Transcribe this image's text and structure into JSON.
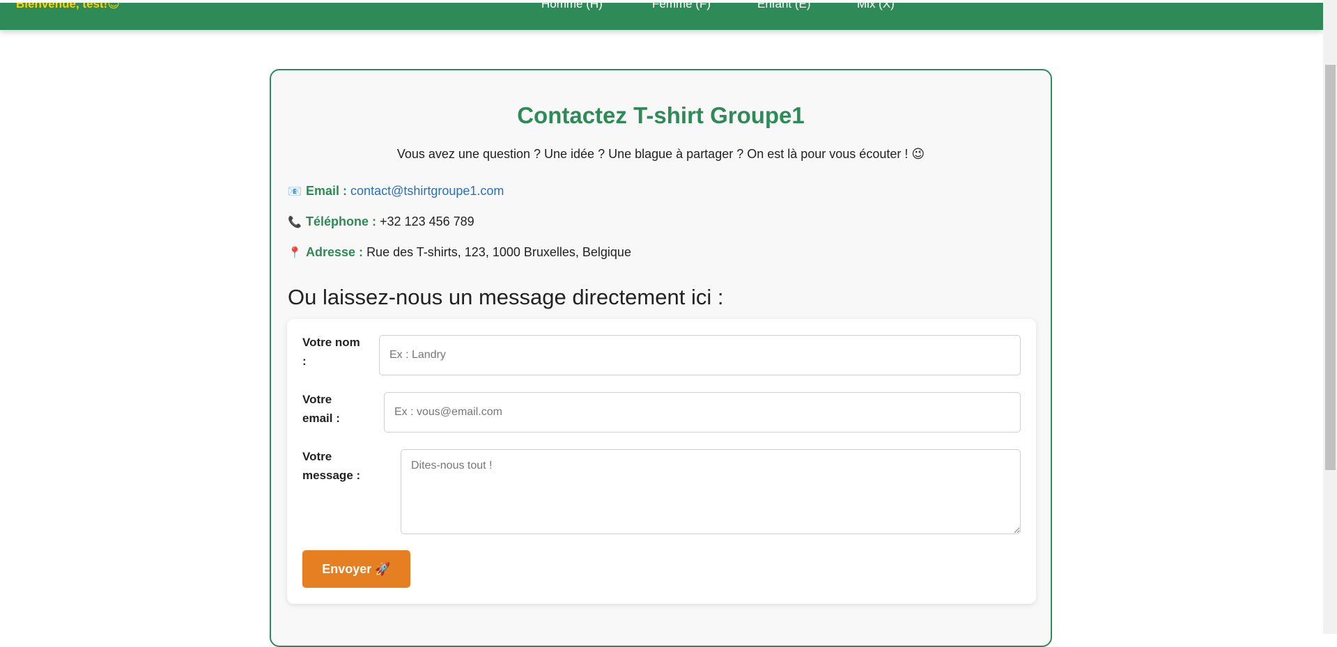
{
  "navbar": {
    "welcome": "Bienvenue, test!😊",
    "links": [
      "Homme (H)",
      "Femme (F)",
      "Enfant (E)",
      "Mix (X)"
    ],
    "bg_color": "#2e8b57",
    "welcome_color": "#ffd200"
  },
  "contact": {
    "title": "Contactez T-shirt Groupe1",
    "subtitle": "Vous avez une question ? Une idée ? Une blague à partager ? On est là pour vous écouter ! 😉",
    "email": {
      "icon": "envelope-icon",
      "glyph": "📧",
      "label": "Email :",
      "value": "contact@tshirtgroupe1.com"
    },
    "phone": {
      "icon": "phone-icon",
      "glyph": "📞",
      "label": "Téléphone :",
      "value": "+32 123 456 789"
    },
    "address": {
      "icon": "pin-icon",
      "glyph": "📍",
      "label": "Adresse :",
      "value": "Rue des T-shirts, 123, 1000 Bruxelles, Belgique"
    }
  },
  "form": {
    "heading": "Ou laissez-nous un message directement ici :",
    "name_label_1": "Votre nom",
    "name_label_2": ":",
    "name_placeholder": "Ex : Landry",
    "email_label_1": "Votre",
    "email_label_2": "email :",
    "email_placeholder": "Ex : vous@email.com",
    "message_label_1": "Votre",
    "message_label_2": "message :",
    "message_placeholder": "Dites-nous tout !",
    "submit_label": "Envoyer 🚀",
    "submit_color": "#e67e22"
  }
}
